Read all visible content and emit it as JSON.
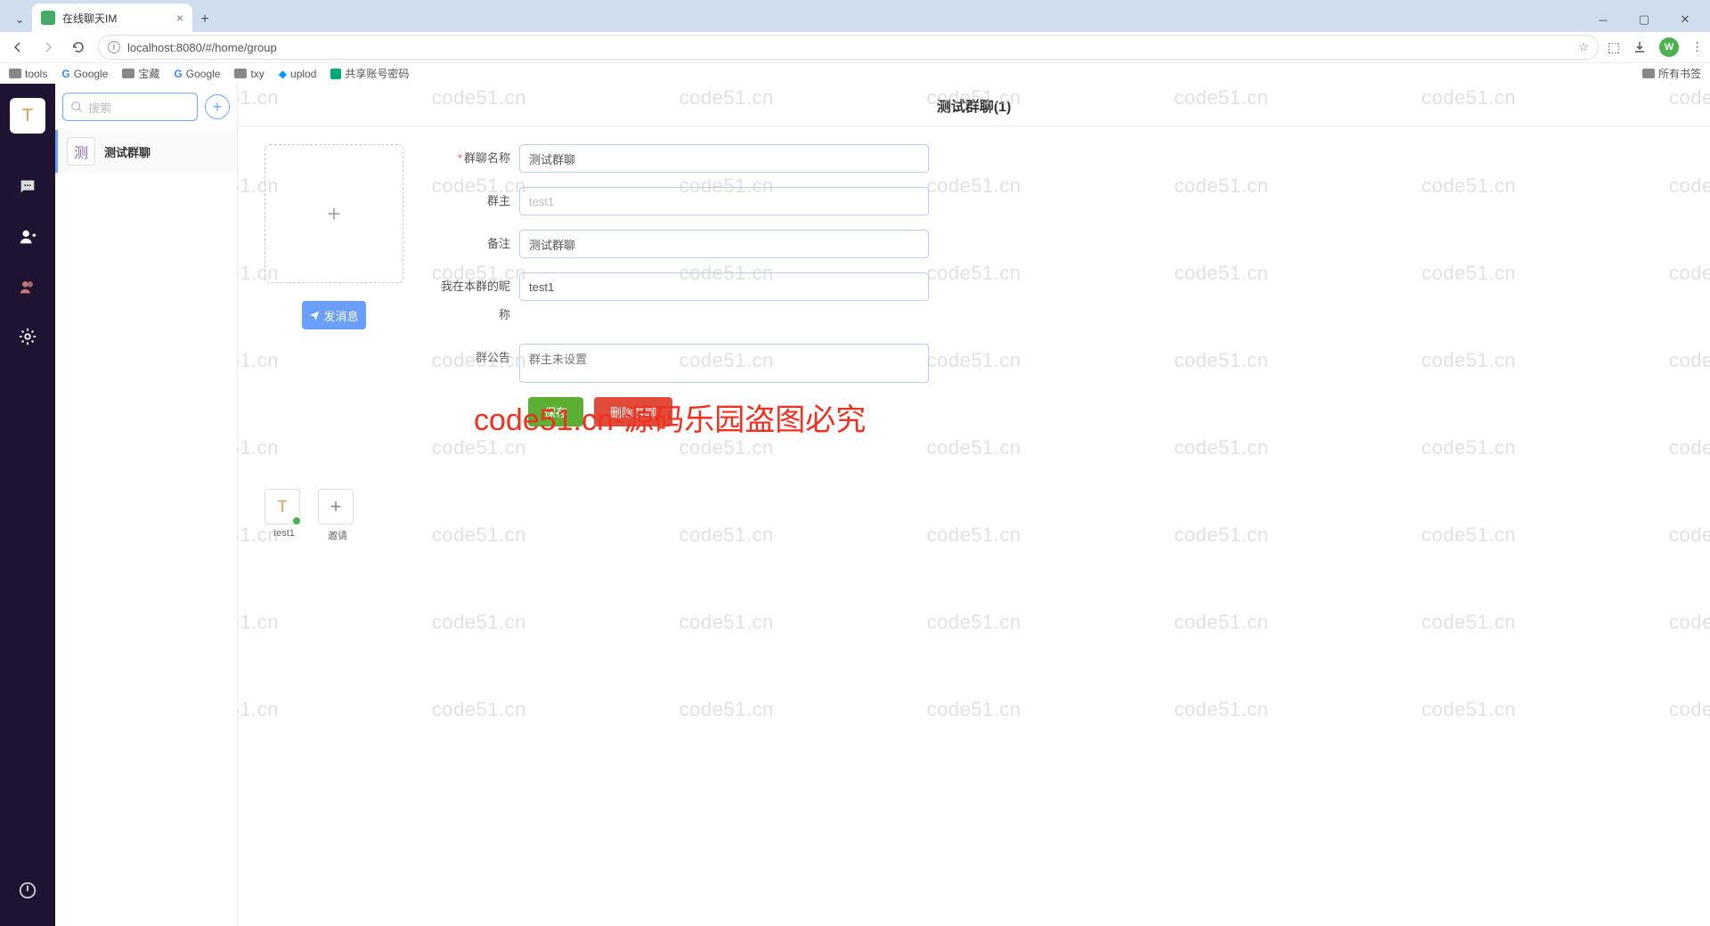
{
  "browser": {
    "tab_title": "在线聊天IM",
    "url": "localhost:8080/#/home/group",
    "profile_letter": "W",
    "bookmarks": [
      "tools",
      "Google",
      "宝藏",
      "Google",
      "txy",
      "uplod",
      "共享账号密码"
    ],
    "all_bookmarks": "所有书签"
  },
  "sidebar": {
    "avatar_letter": "T"
  },
  "conv": {
    "search_placeholder": "搜索",
    "items": [
      {
        "avatar": "测",
        "name": "测试群聊"
      }
    ]
  },
  "group": {
    "title": "测试群聊(1)",
    "send_msg": "发消息",
    "form": {
      "name_label": "群聊名称",
      "name_value": "测试群聊",
      "owner_label": "群主",
      "owner_value": "test1",
      "remark_label": "备注",
      "remark_value": "测试群聊",
      "nickname_label": "我在本群的昵称",
      "nickname_value": "test1",
      "notice_label": "群公告",
      "notice_placeholder": "群主未设置"
    },
    "btn_save": "保存",
    "btn_delete": "删除群聊",
    "members": [
      {
        "avatar": "T",
        "name": "test1",
        "online": true
      }
    ],
    "invite_label": "邀请"
  },
  "watermark": {
    "text": "code51.cn",
    "banner": "code51.cn-源码乐园盗图必究"
  }
}
